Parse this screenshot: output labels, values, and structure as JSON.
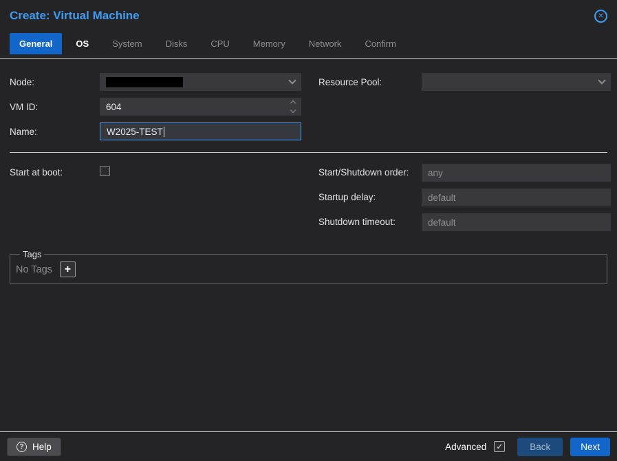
{
  "colors": {
    "accent": "#1366c9",
    "title_text": "#3f9cf0"
  },
  "dialog": {
    "title": "Create: Virtual Machine"
  },
  "tabs": [
    {
      "label": "General",
      "state": "active"
    },
    {
      "label": "OS",
      "state": "enabled"
    },
    {
      "label": "System",
      "state": "disabled"
    },
    {
      "label": "Disks",
      "state": "disabled"
    },
    {
      "label": "CPU",
      "state": "disabled"
    },
    {
      "label": "Memory",
      "state": "disabled"
    },
    {
      "label": "Network",
      "state": "disabled"
    },
    {
      "label": "Confirm",
      "state": "disabled"
    }
  ],
  "form": {
    "node": {
      "label": "Node:",
      "value_redacted": true
    },
    "vmid": {
      "label": "VM ID:",
      "value": "604"
    },
    "name": {
      "label": "Name:",
      "value": "W2025-TEST"
    },
    "resource_pool": {
      "label": "Resource Pool:",
      "value": ""
    },
    "start_at_boot": {
      "label": "Start at boot:",
      "checked": false
    },
    "start_shutdown_order": {
      "label": "Start/Shutdown order:",
      "placeholder": "any"
    },
    "startup_delay": {
      "label": "Startup delay:",
      "placeholder": "default"
    },
    "shutdown_timeout": {
      "label": "Shutdown timeout:",
      "placeholder": "default"
    }
  },
  "tags": {
    "legend": "Tags",
    "empty_text": "No Tags",
    "add_label": "+"
  },
  "footer": {
    "help": "Help",
    "advanced": "Advanced",
    "advanced_checked": true,
    "back": "Back",
    "next": "Next"
  }
}
